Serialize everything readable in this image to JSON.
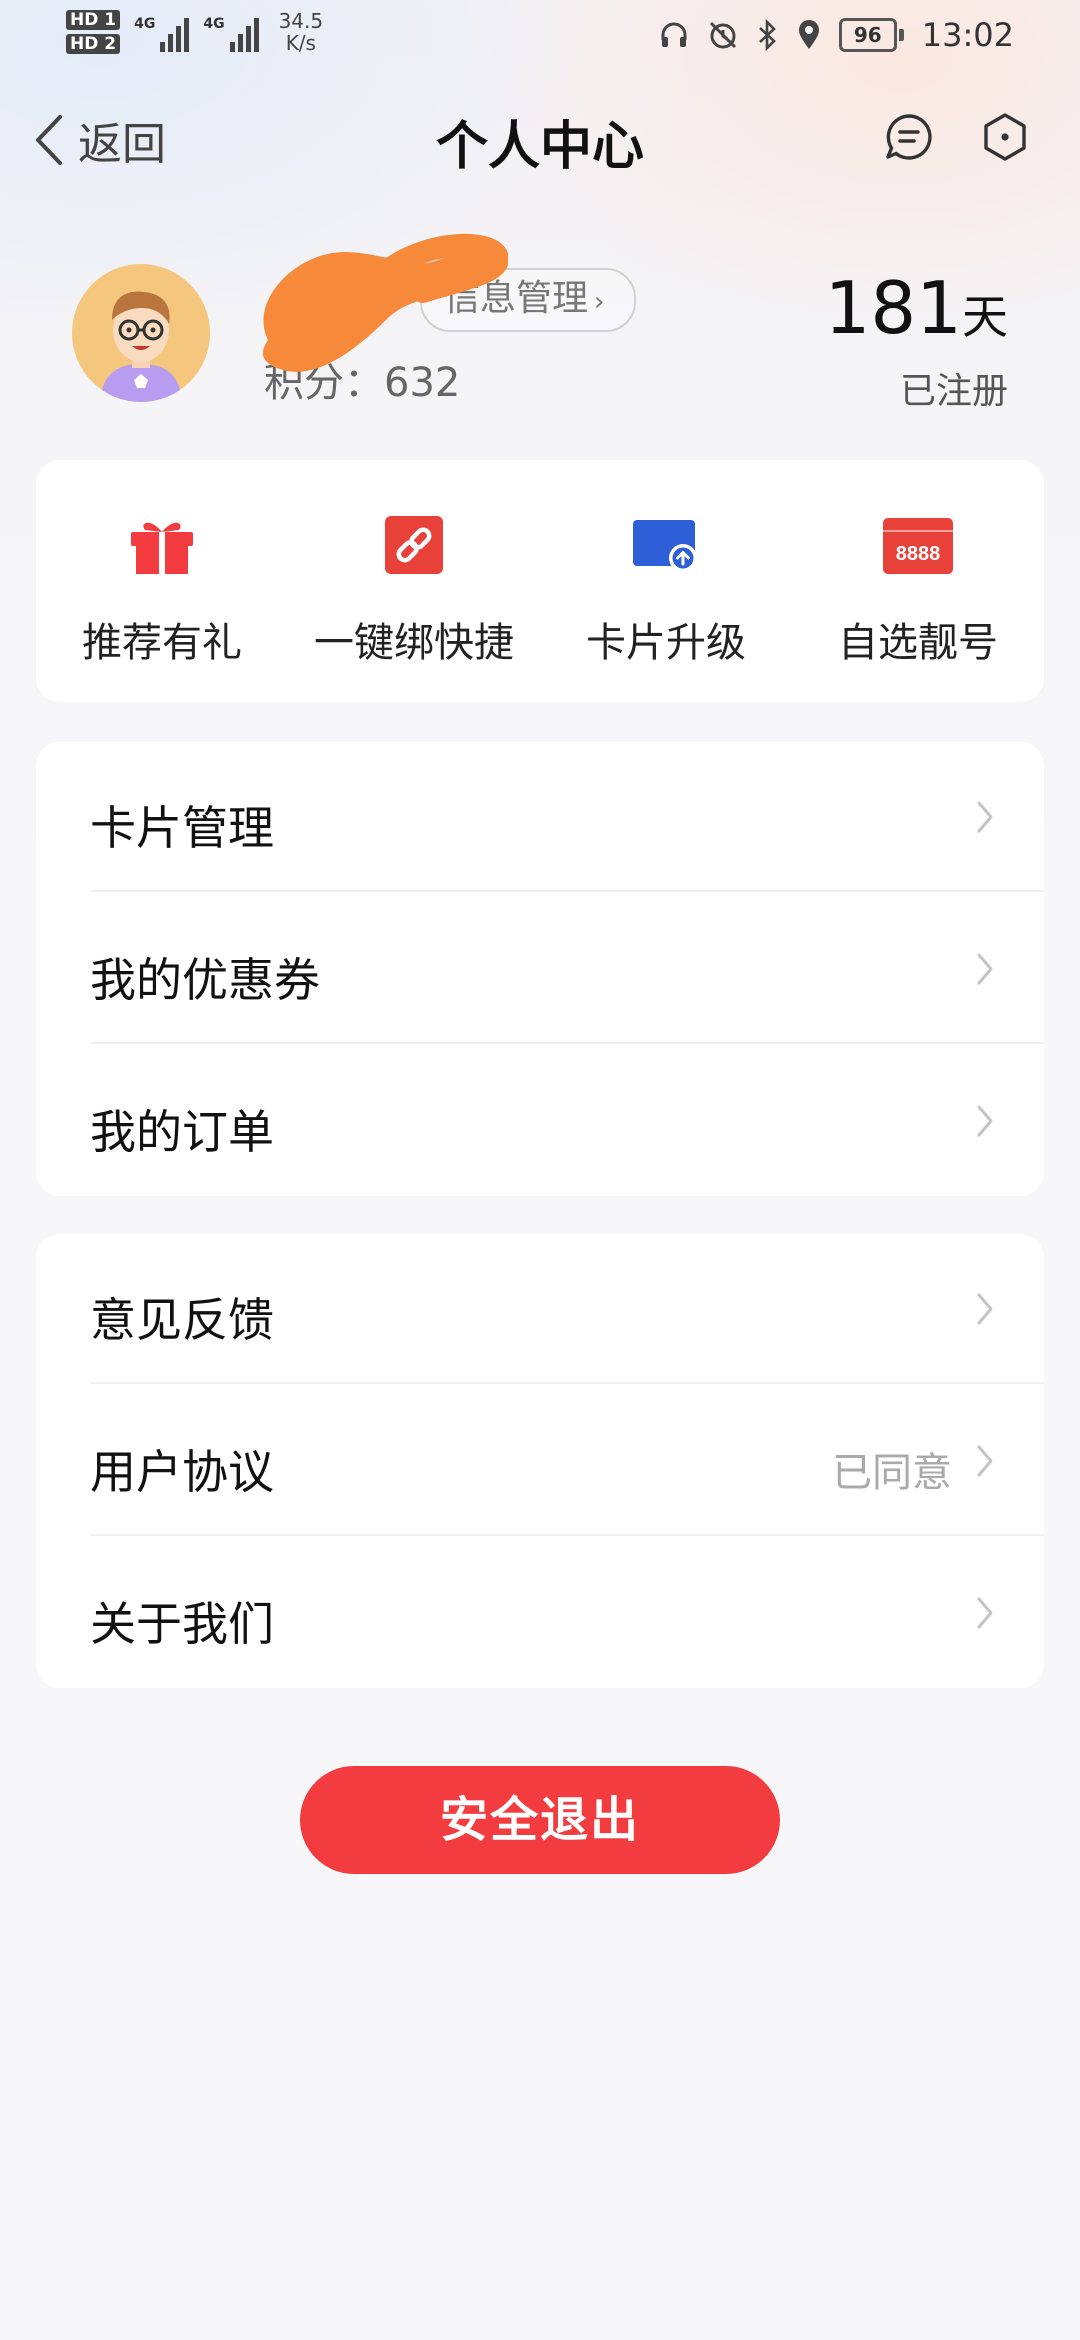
{
  "status_bar": {
    "sim1": "HD 1",
    "sim2": "HD 2",
    "net1": "4G",
    "net2": "4G",
    "speed_value": "34.5",
    "speed_unit": "K/s",
    "battery": "96",
    "time": "13:02"
  },
  "header": {
    "back_label": "返回",
    "title": "个人中心"
  },
  "profile": {
    "info_manage_label": "信息管理",
    "points_label": "积分：632",
    "days_value": "181",
    "days_unit": "天",
    "days_caption": "已注册"
  },
  "quick_actions": [
    {
      "label": "推荐有礼",
      "icon": "gift-icon",
      "color": "#f23c40"
    },
    {
      "label": "一键绑快捷",
      "icon": "link-icon",
      "color": "#e8413a"
    },
    {
      "label": "卡片升级",
      "icon": "card-upgrade-icon",
      "color": "#2e5fd8"
    },
    {
      "label": "自选靓号",
      "icon": "number-8888-icon",
      "color": "#e8413a",
      "text": "8888"
    }
  ],
  "menu_group_1": [
    {
      "label": "卡片管理"
    },
    {
      "label": "我的优惠券"
    },
    {
      "label": "我的订单"
    }
  ],
  "menu_group_2": [
    {
      "label": "意见反馈",
      "value": ""
    },
    {
      "label": "用户协议",
      "value": "已同意"
    },
    {
      "label": "关于我们",
      "value": ""
    }
  ],
  "logout_label": "安全退出"
}
